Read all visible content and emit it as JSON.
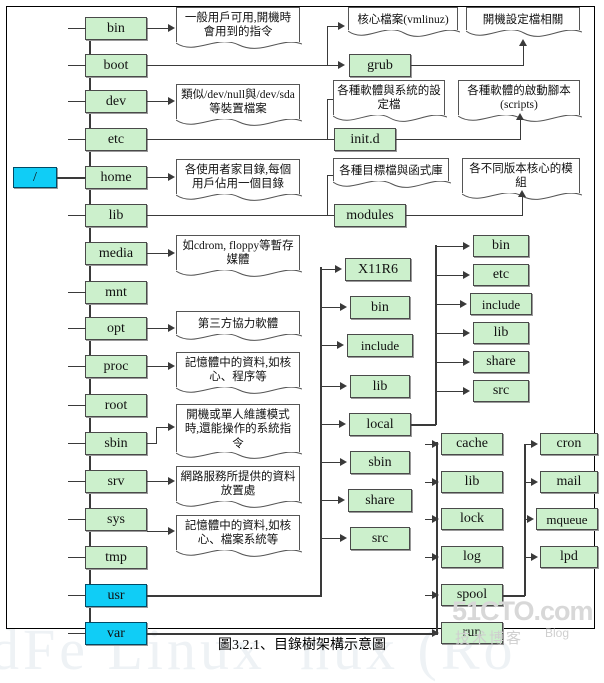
{
  "figure": {
    "caption": "圖3.2.1、目錄樹架構示意圖",
    "watermark_main": "51CTO.com",
    "watermark_sub": "技术博客",
    "watermark_blog": "Blog",
    "bg_watermark_1": "dFe Linux",
    "bg_watermark_2": "nux (Ro",
    "colors": {
      "node_fill": "#ccf0cc",
      "node_highlight_fill": "#10cdf6",
      "node_border": "#4a4a4a",
      "line": "#3a3a3a",
      "background": "#ffffff"
    }
  },
  "root": {
    "label": "/"
  },
  "level1": [
    {
      "label": "bin"
    },
    {
      "label": "boot"
    },
    {
      "label": "dev"
    },
    {
      "label": "etc"
    },
    {
      "label": "home"
    },
    {
      "label": "lib"
    },
    {
      "label": "media"
    },
    {
      "label": "mnt"
    },
    {
      "label": "opt"
    },
    {
      "label": "proc"
    },
    {
      "label": "root"
    },
    {
      "label": "sbin"
    },
    {
      "label": "srv"
    },
    {
      "label": "sys"
    },
    {
      "label": "tmp"
    },
    {
      "label": "usr"
    },
    {
      "label": "var"
    }
  ],
  "boot_children": [
    {
      "label": "grub"
    }
  ],
  "etc_children": [
    {
      "label": "init.d"
    }
  ],
  "lib_children": [
    {
      "label": "modules"
    }
  ],
  "usr_children": [
    {
      "label": "X11R6"
    },
    {
      "label": "bin"
    },
    {
      "label": "include"
    },
    {
      "label": "lib"
    },
    {
      "label": "local"
    },
    {
      "label": "sbin"
    },
    {
      "label": "share"
    },
    {
      "label": "src"
    }
  ],
  "usr_local_children": [
    {
      "label": "bin"
    },
    {
      "label": "etc"
    },
    {
      "label": "include"
    },
    {
      "label": "lib"
    },
    {
      "label": "share"
    },
    {
      "label": "src"
    }
  ],
  "var_children": [
    {
      "label": "cache"
    },
    {
      "label": "lib"
    },
    {
      "label": "lock"
    },
    {
      "label": "log"
    },
    {
      "label": "spool"
    },
    {
      "label": "run"
    }
  ],
  "var_spool_children": [
    {
      "label": "cron"
    },
    {
      "label": "mail"
    },
    {
      "label": "mqueue"
    },
    {
      "label": "lpd"
    }
  ],
  "notes": {
    "bin": "一般用戶可用,開機時會用到的指令",
    "dev": "類似/dev/null與/dev/sda等裝置檔案",
    "home": "各使用者家目錄,每個用戶佔用一個目錄",
    "media": "如cdrom, floppy等暫存媒體",
    "opt": "第三方協力軟體",
    "proc": "記憶體中的資料,如核心、程序等",
    "sbin": "開機或單人維護模式時,還能操作的系統指令",
    "srv": "網路服務所提供的資料放置處",
    "sys": "記憶體中的資料,如核心、檔案系統等",
    "grub_parent": "核心檔案(vmlinuz)",
    "grub_child": "開機設定檔相關",
    "initd_parent": "各種軟體與系統的設定檔",
    "initd_child": "各種軟體的啟動腳本(scripts)",
    "modules_parent": "各種目標檔與函式庫",
    "modules_child": "各不同版本核心的模組"
  }
}
